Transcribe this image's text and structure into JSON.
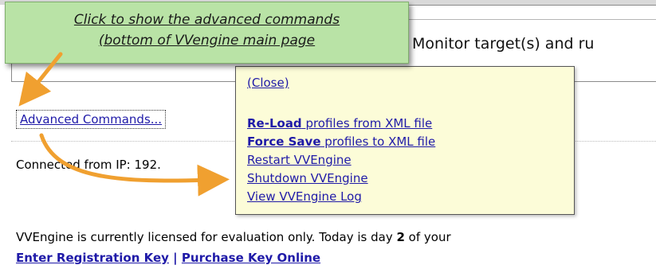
{
  "callout": {
    "line1": "Click to show the advanced commands",
    "line2": "(bottom of VVengine main page"
  },
  "header": {
    "monitor_text": "Monitor target(s) and ru"
  },
  "advanced_commands_link": "Advanced Commands...",
  "connected_text": "Connected from IP: 192.",
  "popup": {
    "close_label": "(Close)",
    "items": [
      {
        "bold": "Re-Load",
        "rest": " profiles from XML file"
      },
      {
        "bold": "Force Save",
        "rest": " profiles to XML file"
      },
      {
        "bold": "",
        "rest": "Restart VVEngine"
      },
      {
        "bold": "",
        "rest": "Shutdown VVEngine"
      },
      {
        "bold": "",
        "rest": "View VVEngine Log"
      }
    ]
  },
  "license": {
    "text_before": "VVEngine is currently licensed for evaluation only. Today is day ",
    "day": "2",
    "text_after": " of your"
  },
  "registration": {
    "enter_key": "Enter Registration Key",
    "separator": " | ",
    "purchase": "Purchase Key Online"
  },
  "colors": {
    "callout_bg": "#b9e3a6",
    "popup_bg": "#fcfcd8",
    "link": "#1f1aa8",
    "arrow": "#f0a030"
  }
}
